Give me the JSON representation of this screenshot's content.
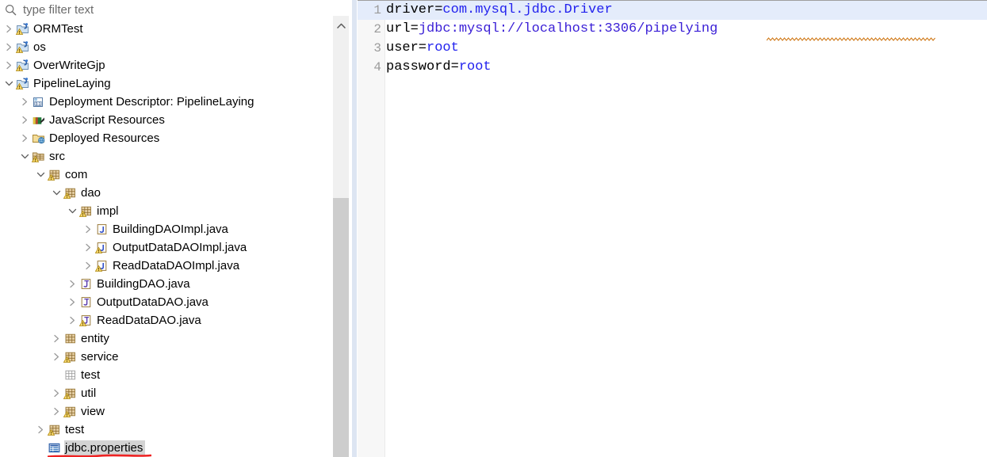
{
  "explorer": {
    "filter": {
      "placeholder": "type filter text",
      "value": "",
      "icon": "search-icon"
    },
    "tree": [
      {
        "label": "ORMTest",
        "indent": 0,
        "twisty": "collapsed",
        "icon": "java-project-warning-icon"
      },
      {
        "label": "os",
        "indent": 0,
        "twisty": "collapsed",
        "icon": "java-project-warning-icon"
      },
      {
        "label": "OverWriteGjp",
        "indent": 0,
        "twisty": "collapsed",
        "icon": "java-project-warning-icon"
      },
      {
        "label": "PipelineLaying",
        "indent": 0,
        "twisty": "expanded",
        "icon": "java-project-warning-icon"
      },
      {
        "label": "Deployment Descriptor: PipelineLaying",
        "indent": 1,
        "twisty": "collapsed",
        "icon": "deployment-descriptor-icon"
      },
      {
        "label": "JavaScript Resources",
        "indent": 1,
        "twisty": "collapsed",
        "icon": "javascript-resources-icon"
      },
      {
        "label": "Deployed Resources",
        "indent": 1,
        "twisty": "collapsed",
        "icon": "deployed-resources-icon"
      },
      {
        "label": "src",
        "indent": 1,
        "twisty": "expanded",
        "icon": "source-folder-warning-icon"
      },
      {
        "label": "com",
        "indent": 2,
        "twisty": "expanded",
        "icon": "package-warning-icon"
      },
      {
        "label": "dao",
        "indent": 3,
        "twisty": "expanded",
        "icon": "package-warning-icon"
      },
      {
        "label": "impl",
        "indent": 4,
        "twisty": "expanded",
        "icon": "package-warning-icon"
      },
      {
        "label": "BuildingDAOImpl.java",
        "indent": 5,
        "twisty": "collapsed",
        "icon": "java-file-icon"
      },
      {
        "label": "OutputDataDAOImpl.java",
        "indent": 5,
        "twisty": "collapsed",
        "icon": "java-file-warning-icon"
      },
      {
        "label": "ReadDataDAOImpl.java",
        "indent": 5,
        "twisty": "collapsed",
        "icon": "java-file-warning-icon"
      },
      {
        "label": "BuildingDAO.java",
        "indent": 4,
        "twisty": "collapsed",
        "icon": "java-interface-icon"
      },
      {
        "label": "OutputDataDAO.java",
        "indent": 4,
        "twisty": "collapsed",
        "icon": "java-interface-icon"
      },
      {
        "label": "ReadDataDAO.java",
        "indent": 4,
        "twisty": "collapsed",
        "icon": "java-interface-warning-icon"
      },
      {
        "label": "entity",
        "indent": 3,
        "twisty": "collapsed",
        "icon": "package-icon"
      },
      {
        "label": "service",
        "indent": 3,
        "twisty": "collapsed",
        "icon": "package-warning-icon"
      },
      {
        "label": "test",
        "indent": 3,
        "twisty": "none",
        "icon": "package-empty-icon"
      },
      {
        "label": "util",
        "indent": 3,
        "twisty": "collapsed",
        "icon": "package-warning-icon"
      },
      {
        "label": "view",
        "indent": 3,
        "twisty": "collapsed",
        "icon": "package-warning-icon"
      },
      {
        "label": "test",
        "indent": 2,
        "twisty": "collapsed",
        "icon": "package-warning-icon"
      },
      {
        "label": "jdbc.properties",
        "indent": 2,
        "twisty": "none",
        "icon": "properties-file-icon",
        "selected": true
      }
    ],
    "scrollbar": {
      "up_arrow": "chevron-up-icon"
    }
  },
  "editor": {
    "lines": [
      {
        "number": "1",
        "current": true,
        "segments": [
          {
            "text": "driver=",
            "style": "key"
          },
          {
            "text": "com.mysql.jdbc.Driver",
            "style": "value"
          }
        ]
      },
      {
        "number": "2",
        "current": false,
        "segments": [
          {
            "text": "url=",
            "style": "key"
          },
          {
            "text": "jdbc:mysql://localhost:3306/pipelying",
            "style": "value-purple"
          }
        ]
      },
      {
        "number": "3",
        "current": false,
        "segments": [
          {
            "text": "user=",
            "style": "key"
          },
          {
            "text": "root",
            "style": "value"
          }
        ]
      },
      {
        "number": "4",
        "current": false,
        "segments": [
          {
            "text": "password=",
            "style": "key"
          },
          {
            "text": "root",
            "style": "value"
          }
        ]
      }
    ],
    "annotations": {
      "spellcheck_squiggle_text": "localhost:3306/pipelying",
      "red_underline_code_text": "pipelying",
      "red_underline_tree_text": "jdbc.properties"
    }
  },
  "colors": {
    "key": "#000000",
    "value": "#2222ee",
    "value_purple": "#3a1fd6",
    "current_line": "#e4ecfb",
    "selection": "#d4d4d4",
    "annotation_red": "#ee2222",
    "spellcheck_orange": "#d07a1a",
    "gutter_number": "#9b9b9b",
    "divider": "#dde5f2",
    "scrollbar_thumb": "#cdcdcd"
  }
}
